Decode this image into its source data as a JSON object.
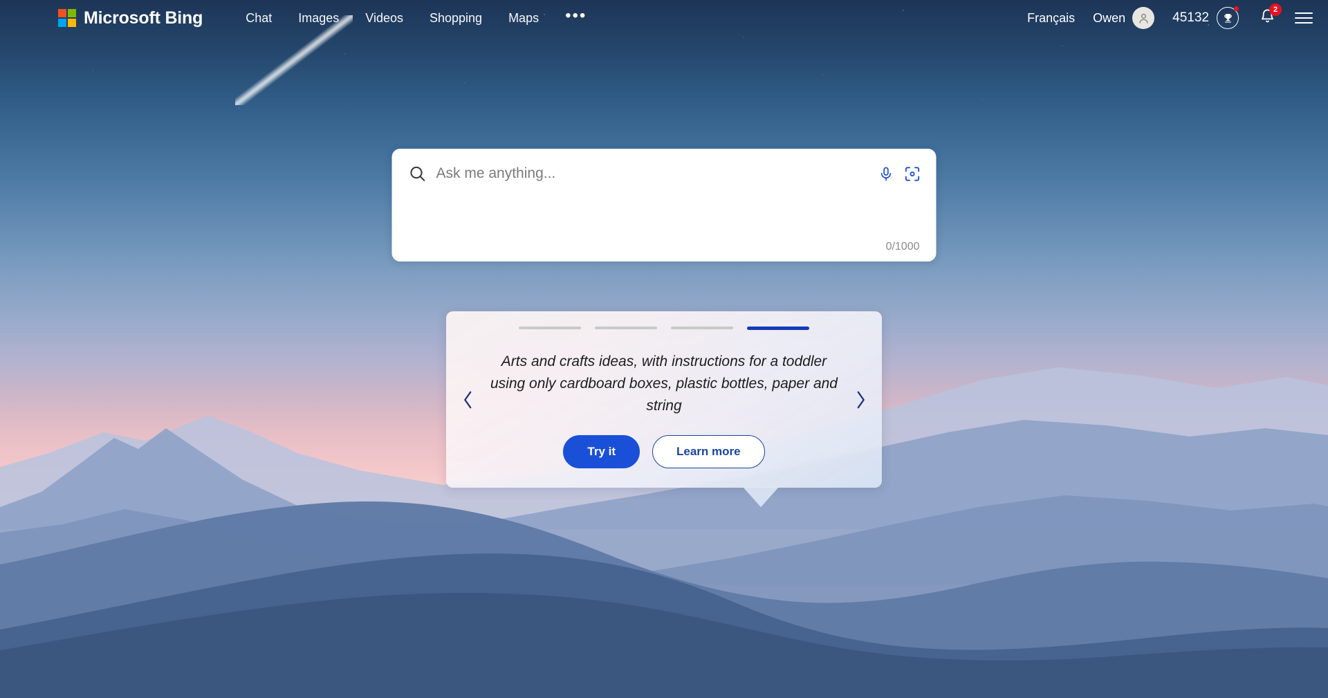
{
  "header": {
    "brand": {
      "name": "Microsoft Bing",
      "logo_icon": "microsoft-logo-icon"
    },
    "nav": [
      {
        "label": "Chat"
      },
      {
        "label": "Images"
      },
      {
        "label": "Videos"
      },
      {
        "label": "Shopping"
      },
      {
        "label": "Maps"
      }
    ],
    "more_label": "•••",
    "language": "Français",
    "account": {
      "name": "Owen",
      "avatar_icon": "person-avatar-icon"
    },
    "rewards": {
      "points": "45132",
      "icon": "rewards-trophy-icon",
      "has_alert_dot": true
    },
    "notifications": {
      "count": "2",
      "icon": "bell-icon"
    },
    "menu_icon": "hamburger-menu-icon"
  },
  "search": {
    "placeholder": "Ask me anything...",
    "value": "",
    "counter": "0/1000",
    "search_icon": "search-icon",
    "mic_icon": "microphone-icon",
    "visual_search_icon": "visual-search-camera-icon"
  },
  "suggestion_card": {
    "text": "Arts and crafts ideas, with instructions for a toddler using only cardboard boxes, plastic bottles, paper and string",
    "dots_total": 4,
    "dots_active_index": 3,
    "prev_icon": "chevron-left-icon",
    "next_icon": "chevron-right-icon",
    "primary_button": "Try it",
    "secondary_button": "Learn more"
  },
  "colors": {
    "accent_blue": "#1a50d8",
    "active_dot_blue": "#123bb8",
    "badge_red": "#e81123",
    "outline_blue": "#17459c"
  }
}
